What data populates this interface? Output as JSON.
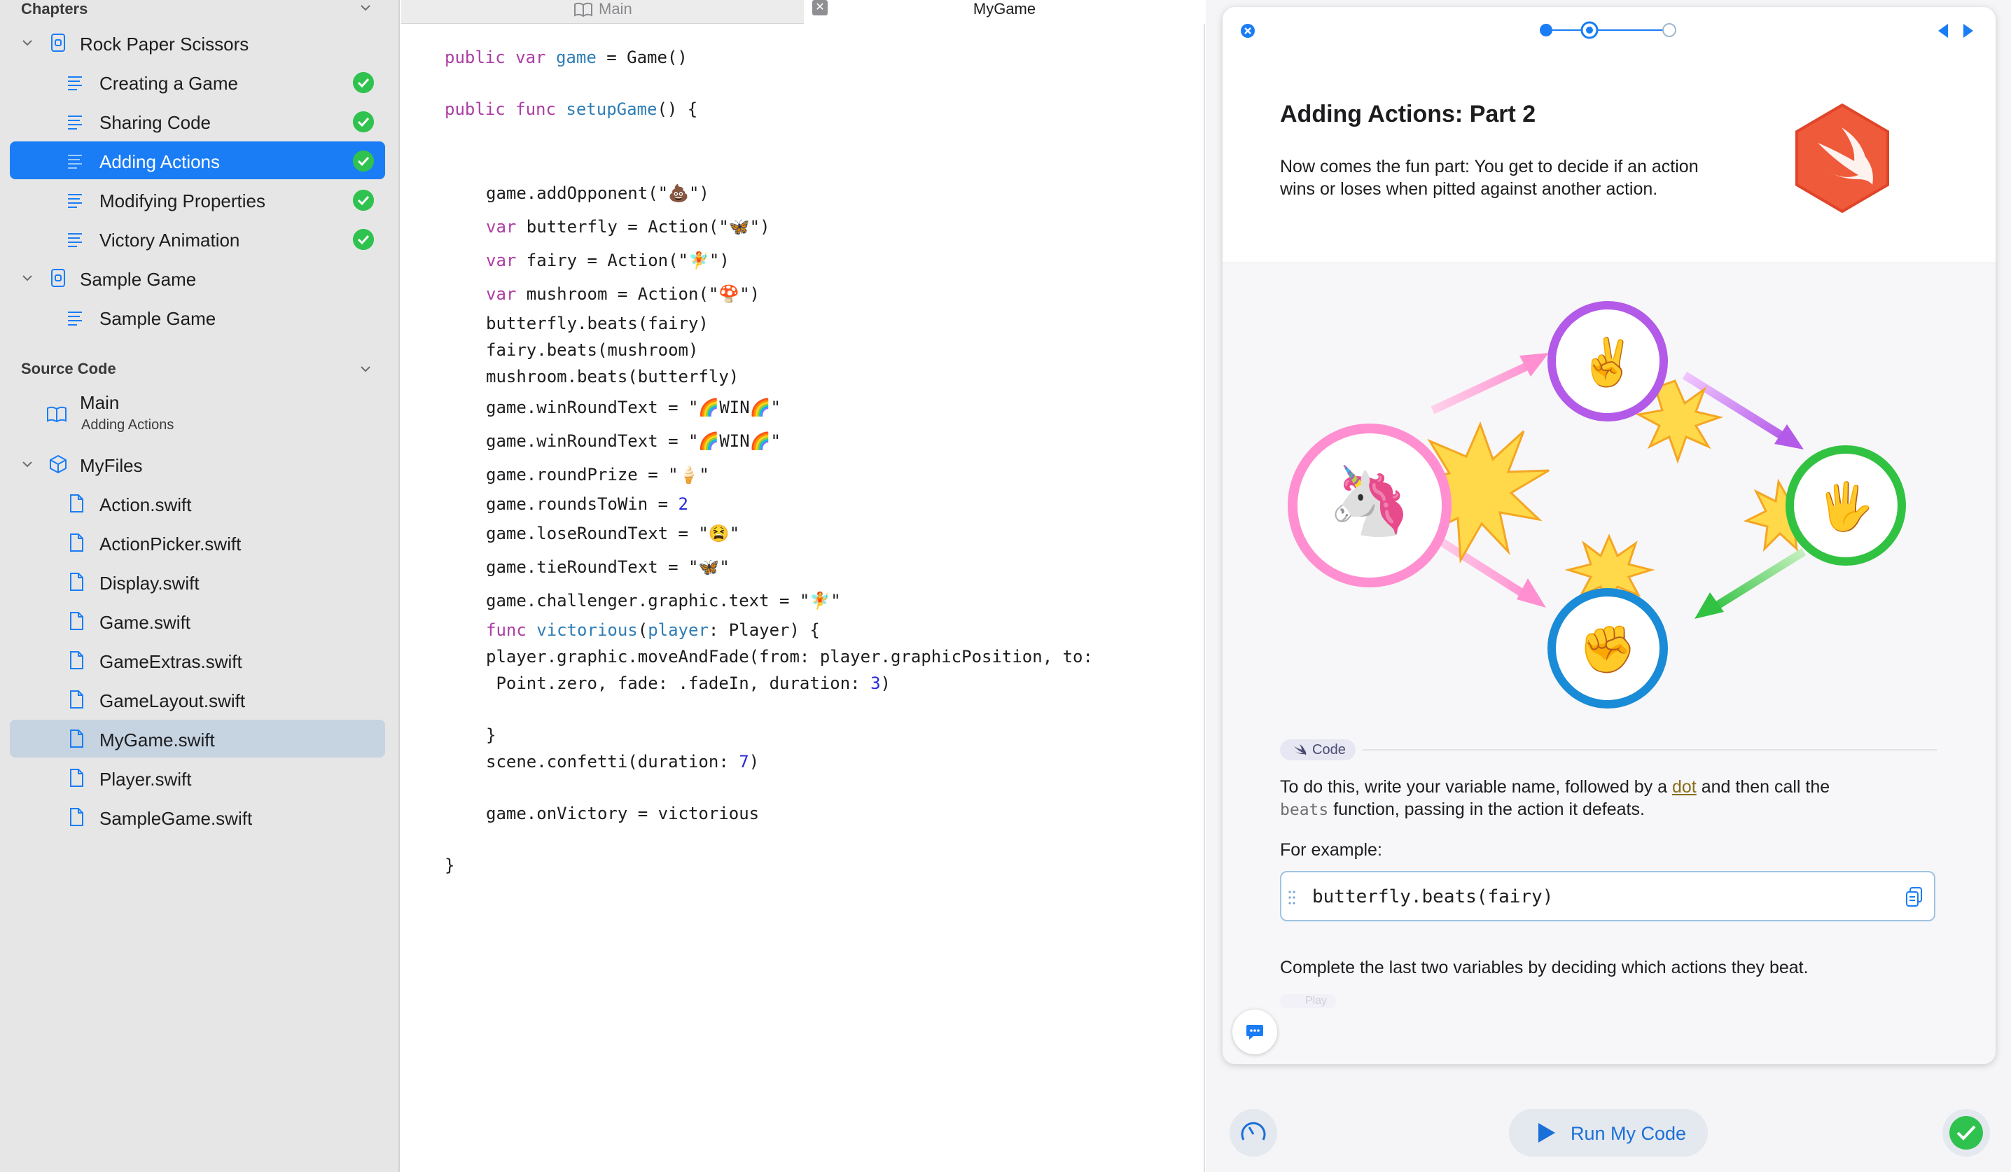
{
  "sidebar": {
    "chapters_header": "Chapters",
    "book_title": "Rock Paper Scissors",
    "pages": [
      {
        "label": "Creating a Game",
        "completed": true
      },
      {
        "label": "Sharing Code",
        "completed": true
      },
      {
        "label": "Adding Actions",
        "completed": true,
        "selected": true
      },
      {
        "label": "Modifying Properties",
        "completed": true
      },
      {
        "label": "Victory Animation",
        "completed": true
      }
    ],
    "sample_group": "Sample Game",
    "sample_page": "Sample Game",
    "source_header": "Source Code",
    "main_item": {
      "label": "Main",
      "sublabel": "Adding Actions"
    },
    "myfiles_label": "MyFiles",
    "files": [
      "Action.swift",
      "ActionPicker.swift",
      "Display.swift",
      "Game.swift",
      "GameExtras.swift",
      "GameLayout.swift",
      "MyGame.swift",
      "Player.swift",
      "SampleGame.swift"
    ],
    "selected_file": "MyGame.swift"
  },
  "editor": {
    "tabs": [
      "Main",
      "MyGame"
    ],
    "active_tab": "MyGame",
    "code_lines": {
      "l1": "public var game = Game()",
      "l2": "public func setupGame() {",
      "l3": "game.addOpponent(\"💩\")",
      "l4": "var butterfly = Action(\"🦋\")",
      "l5": "var fairy = Action(\"🧚\")",
      "l6": "var mushroom = Action(\"🍄\")",
      "l7": "butterfly.beats(fairy)",
      "l8": "fairy.beats(mushroom)",
      "l9": "mushroom.beats(butterfly)",
      "l10": "game.winRoundText = \"🌈WIN🌈\"",
      "l11": "game.winRoundText = \"🌈WIN🌈\"",
      "l12": "game.roundPrize = \"🍦\"",
      "l13": "game.roundsToWin = 2",
      "l14": "game.loseRoundText = \"😫\"",
      "l15": "game.tieRoundText = \"🦋\"",
      "l16": "game.challenger.graphic.text = \"🧚\"",
      "l17": "func victorious(player: Player) {",
      "l18": "player.graphic.moveAndFade(from: player.graphicPosition, to:",
      "l19": " Point.zero, fade: .fadeIn, duration: 3)",
      "l20": "}",
      "l21": "scene.confetti(duration: 7)",
      "l22": "game.onVictory = victorious",
      "l23": "}"
    }
  },
  "guide": {
    "title": "Adding Actions: Part 2",
    "intro": "Now comes the fun part: You get to decide if an action wins or loses when pitted against another action.",
    "diagram_emojis": {
      "left": "🦄",
      "top": "✌️",
      "right": "🖐️",
      "bottom": "✊"
    },
    "code_chip": "Code",
    "para1_before": "To do this, write your variable name, followed by a ",
    "para1_link": "dot",
    "para1_after": " and then call the",
    "para1_mono": "beats",
    "para1_end": " function, passing in the action it defeats.",
    "for_example": "For example:",
    "example_code": "butterfly.beats(fairy)",
    "para2": "Complete the last two variables by deciding which actions they beat.",
    "faded_chip": "Play"
  },
  "bottom": {
    "run_label": "Run My Code"
  },
  "colors": {
    "accent": "#1a7df5",
    "success": "#30c24e",
    "keyword": "#ad3da4",
    "identifier": "#2f7db5",
    "number": "#272ad8"
  }
}
